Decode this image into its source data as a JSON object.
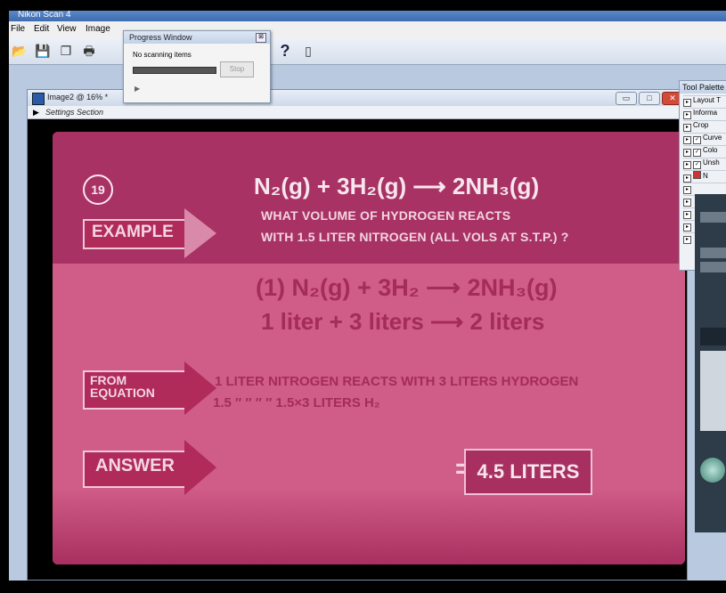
{
  "app": {
    "title": "Nikon Scan 4",
    "menu": [
      "File",
      "Edit",
      "View",
      "Image"
    ],
    "toolbar_icons": [
      "open-icon",
      "save-icon",
      "copy-icon",
      "print-icon",
      "help-icon",
      "clipboard-icon"
    ],
    "toolbar_help_glyph": "?"
  },
  "progress_window": {
    "title": "Progress Window",
    "status": "No scanning items",
    "stop_label": "Stop",
    "button_glyph": "⊠",
    "expand_glyph": "▶"
  },
  "image_window": {
    "title": "Image2 @ 16% *",
    "settings_label": "Settings Section",
    "minimize_glyph": "▭",
    "maximize_glyph": "□",
    "close_glyph": "✕"
  },
  "tool_palette": {
    "title": "Tool Palette",
    "items": [
      {
        "label": "Layout T",
        "checked": false
      },
      {
        "label": "Informa",
        "checked": false
      },
      {
        "label": "Crop",
        "checked": false
      },
      {
        "label": "Curve",
        "checked": true
      },
      {
        "label": "Colo",
        "checked": true
      },
      {
        "label": "Unsh",
        "checked": true
      },
      {
        "label": "N",
        "checked": false
      }
    ]
  },
  "slide": {
    "number": "19",
    "example_label": "EXAMPLE",
    "equation_main": "N₂(g) + 3H₂(g) ⟶ 2NH₃(g)",
    "question_line1": "WHAT VOLUME OF HYDROGEN REACTS",
    "question_line2": "WITH 1.5 LITER NITROGEN (ALL VOLS AT S.T.P.) ?",
    "equation_work": "(1) N₂(g) + 3H₂ ⟶ 2NH₃(g)",
    "volumes_line": "1 liter  + 3 liters ⟶ 2 liters",
    "from_equation_line1": "FROM",
    "from_equation_line2": "EQUATION",
    "ratio_line1": "1 LITER  NITROGEN  REACTS  WITH 3 LITERS  HYDROGEN",
    "ratio_line2": "1.5  ″          ″            ″          ″   1.5×3 LITERS  H₂",
    "answer_label": "ANSWER",
    "equals": "=",
    "answer_value": "4.5 LITERS"
  },
  "colors": {
    "slide_pink": "#d05c88",
    "slide_dark_band": "#a83264",
    "slide_text_dark": "#a32c5a",
    "slide_text_light": "#f7e6ee",
    "workspace": "#b9c9df"
  }
}
